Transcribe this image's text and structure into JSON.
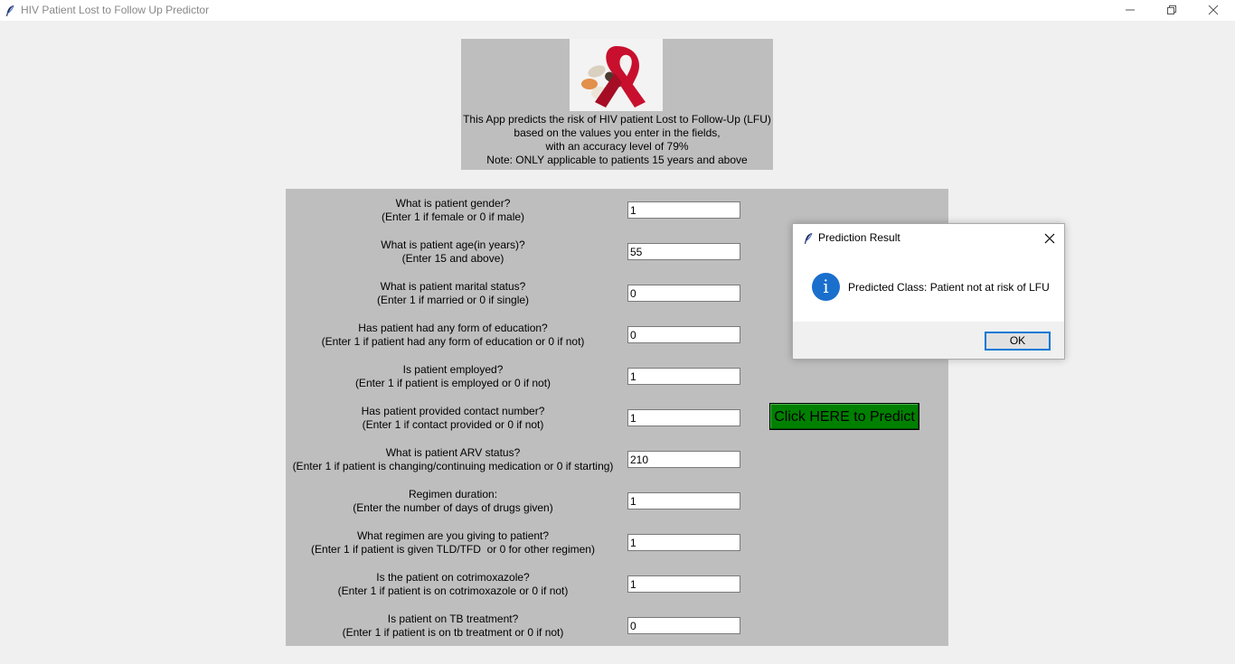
{
  "window": {
    "title": "HIV Patient Lost to Follow Up Predictor",
    "icon": "feather-icon"
  },
  "header": {
    "logo": "hiv-ribbon-pills-image",
    "lines": [
      "This App predicts the risk of HIV patient Lost to Follow-Up (LFU)",
      "based on the values you enter in the fields,",
      "with an accuracy level of 79%",
      "Note: ONLY applicable to patients 15 years and above"
    ]
  },
  "form": {
    "questions": [
      {
        "question": "What is patient gender?",
        "hint": "(Enter 1 if female or 0 if male)",
        "value": "1"
      },
      {
        "question": "What is patient age(in years)?",
        "hint": "(Enter 15 and above)",
        "value": "55"
      },
      {
        "question": "What is patient marital status?",
        "hint": "(Enter 1 if married or 0 if single)",
        "value": "0"
      },
      {
        "question": "Has patient had any form of education?",
        "hint": "(Enter 1 if patient had any form of education or 0 if not)",
        "value": "0"
      },
      {
        "question": "Is patient employed?",
        "hint": "(Enter 1 if patient is employed or 0 if not)",
        "value": "1"
      },
      {
        "question": "Has patient provided contact number?",
        "hint": "(Enter 1 if contact provided or 0 if not)",
        "value": "1"
      },
      {
        "question": "What is patient ARV status?",
        "hint": "(Enter 1 if patient is changing/continuing medication or 0 if starting)",
        "value": "210"
      },
      {
        "question": "Regimen duration:",
        "hint": "(Enter the number of days of drugs given)",
        "value": "1"
      },
      {
        "question": "What regimen are you giving to patient?",
        "hint": "(Enter 1 if patient is given TLD/TFD  or 0 for other regimen)",
        "value": "1"
      },
      {
        "question": "Is the patient on cotrimoxazole?",
        "hint": "(Enter 1 if patient is on cotrimoxazole or 0 if not)",
        "value": "1"
      },
      {
        "question": "Is patient on TB treatment?",
        "hint": "(Enter 1 if patient is on tb treatment or 0 if not)",
        "value": "0"
      }
    ],
    "predict_button": "Click HERE to Predict",
    "predict_color": "#008000"
  },
  "dialog": {
    "title": "Prediction Result",
    "icon": "info-icon",
    "icon_glyph": "i",
    "message": "Predicted Class: Patient not at risk of LFU",
    "ok_label": "OK"
  }
}
